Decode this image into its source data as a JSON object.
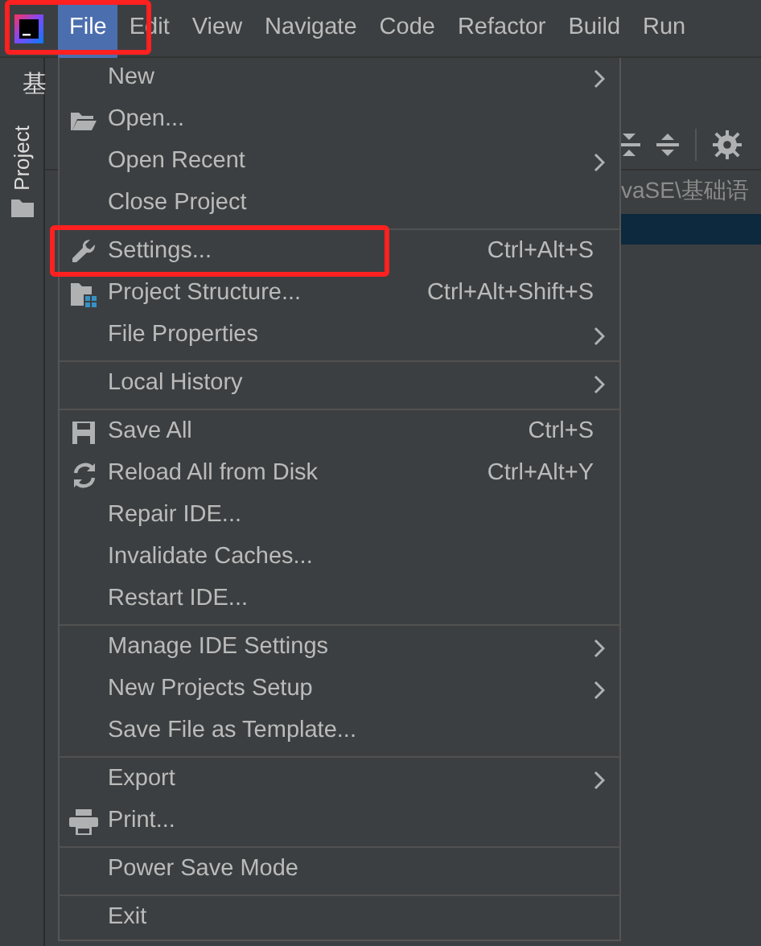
{
  "menu_bar": {
    "items": [
      {
        "label": "File",
        "selected": true
      },
      {
        "label": "Edit",
        "selected": false
      },
      {
        "label": "View",
        "selected": false
      },
      {
        "label": "Navigate",
        "selected": false
      },
      {
        "label": "Code",
        "selected": false
      },
      {
        "label": "Refactor",
        "selected": false
      },
      {
        "label": "Build",
        "selected": false
      },
      {
        "label": "Run",
        "selected": false
      }
    ]
  },
  "editor_tab": {
    "label": "基"
  },
  "side_tool_window": {
    "label": "Project"
  },
  "breadcrumb": {
    "text": "vaSE\\基础语"
  },
  "file_menu": {
    "groups": [
      [
        {
          "kind": "plain",
          "label": "New",
          "has_submenu": true
        },
        {
          "kind": "folder",
          "label": "Open...",
          "has_submenu": false
        },
        {
          "kind": "plain",
          "label": "Open Recent",
          "has_submenu": true
        },
        {
          "kind": "plain",
          "label": "Close Project",
          "has_submenu": false
        }
      ],
      [
        {
          "kind": "wrench",
          "label": "Settings...",
          "shortcut": "Ctrl+Alt+S",
          "has_submenu": false
        },
        {
          "kind": "structure",
          "label": "Project Structure...",
          "shortcut": "Ctrl+Alt+Shift+S",
          "has_submenu": false
        },
        {
          "kind": "plain",
          "label": "File Properties",
          "has_submenu": true
        }
      ],
      [
        {
          "kind": "plain",
          "label": "Local History",
          "has_submenu": true
        }
      ],
      [
        {
          "kind": "save",
          "label": "Save All",
          "shortcut": "Ctrl+S",
          "has_submenu": false
        },
        {
          "kind": "reload",
          "label": "Reload All from Disk",
          "shortcut": "Ctrl+Alt+Y",
          "has_submenu": false
        },
        {
          "kind": "plain",
          "label": "Repair IDE...",
          "has_submenu": false
        },
        {
          "kind": "plain",
          "label": "Invalidate Caches...",
          "has_submenu": false
        },
        {
          "kind": "plain",
          "label": "Restart IDE...",
          "has_submenu": false
        }
      ],
      [
        {
          "kind": "plain",
          "label": "Manage IDE Settings",
          "has_submenu": true
        },
        {
          "kind": "plain",
          "label": "New Projects Setup",
          "has_submenu": true
        },
        {
          "kind": "plain",
          "label": "Save File as Template...",
          "has_submenu": false
        }
      ],
      [
        {
          "kind": "plain",
          "label": "Export",
          "has_submenu": true
        },
        {
          "kind": "print",
          "label": "Print...",
          "has_submenu": false
        }
      ],
      [
        {
          "kind": "plain",
          "label": "Power Save Mode",
          "has_submenu": false
        }
      ],
      [
        {
          "kind": "plain",
          "label": "Exit",
          "has_submenu": false
        }
      ]
    ]
  }
}
